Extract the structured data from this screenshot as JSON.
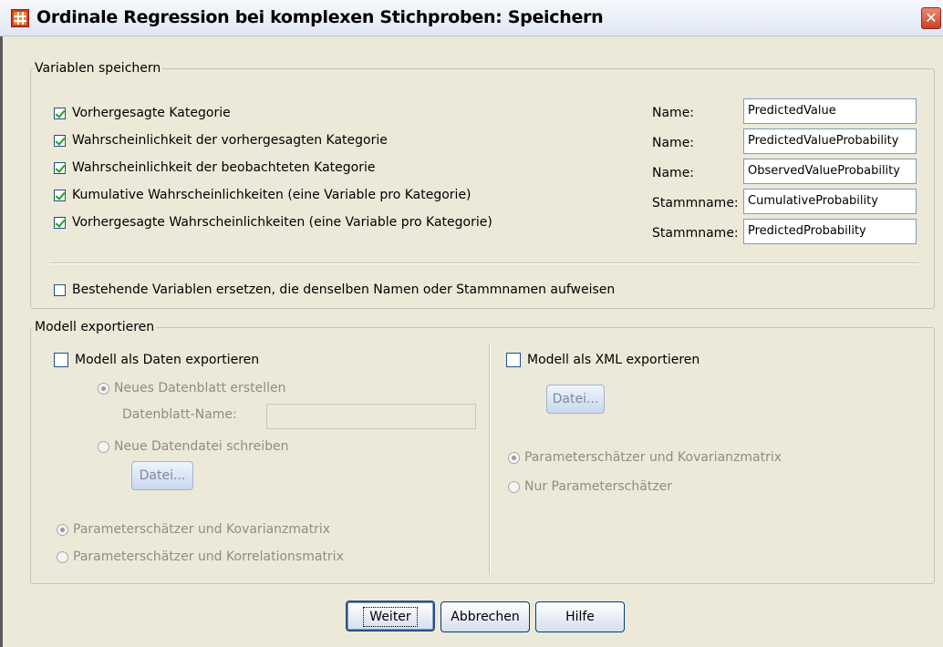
{
  "window": {
    "title": "Ordinale Regression bei komplexen Stichproben: Speichern",
    "close": "✕"
  },
  "save_variables": {
    "legend": "Variablen speichern",
    "items": [
      {
        "label": "Vorhergesagte Kategorie",
        "checked": true,
        "name_label": "Name:",
        "name_value": "PredictedValue"
      },
      {
        "label": "Wahrscheinlichkeit der vorhergesagten Kategorie",
        "checked": true,
        "name_label": "Name:",
        "name_value": "PredictedValueProbability"
      },
      {
        "label": "Wahrscheinlichkeit der beobachteten Kategorie",
        "checked": true,
        "name_label": "Name:",
        "name_value": "ObservedValueProbability"
      },
      {
        "label": "Kumulative Wahrscheinlichkeiten (eine Variable pro Kategorie)",
        "checked": true,
        "name_label": "Stammname:",
        "name_value": "CumulativeProbability"
      },
      {
        "label": "Vorhergesagte Wahrscheinlichkeiten (eine Variable pro Kategorie)",
        "checked": true,
        "name_label": "Stammname:",
        "name_value": "PredictedProbability"
      }
    ],
    "replace_label": "Bestehende Variablen ersetzen, die denselben Namen oder Stammnamen aufweisen"
  },
  "export_model": {
    "legend": "Modell exportieren",
    "as_data": {
      "label": "Modell als Daten exportieren",
      "new_dataset": "Neues Datenblatt erstellen",
      "dataset_name_label": "Datenblatt-Name:",
      "dataset_name_value": "",
      "new_datafile": "Neue Datendatei schreiben",
      "file_button": "Datei...",
      "option_cov": "Parameterschätzer und Kovarianzmatrix",
      "option_corr": "Parameterschätzer und Korrelationsmatrix"
    },
    "as_xml": {
      "label": "Modell als XML exportieren",
      "file_button": "Datei...",
      "option_cov": "Parameterschätzer und Kovarianzmatrix",
      "option_params": "Nur Parameterschätzer"
    }
  },
  "buttons": {
    "continue": "Weiter",
    "cancel": "Abbrechen",
    "help": "Hilfe"
  }
}
